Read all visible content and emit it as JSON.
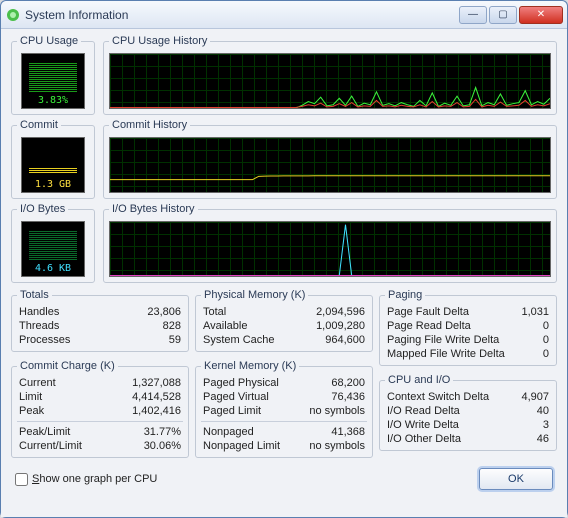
{
  "window": {
    "title": "System Information"
  },
  "sections": {
    "cpu_usage": "CPU Usage",
    "cpu_history": "CPU Usage History",
    "commit": "Commit",
    "commit_history": "Commit History",
    "io": "I/O Bytes",
    "io_history": "I/O Bytes History"
  },
  "meters": {
    "cpu": "3.83%",
    "commit": "1.3 GB",
    "io": "4.6 KB"
  },
  "totals": {
    "legend": "Totals",
    "handles_k": "Handles",
    "handles_v": "23,806",
    "threads_k": "Threads",
    "threads_v": "828",
    "processes_k": "Processes",
    "processes_v": "59"
  },
  "commit_charge": {
    "legend": "Commit Charge (K)",
    "current_k": "Current",
    "current_v": "1,327,088",
    "limit_k": "Limit",
    "limit_v": "4,414,528",
    "peak_k": "Peak",
    "peak_v": "1,402,416",
    "peak_limit_k": "Peak/Limit",
    "peak_limit_v": "31.77%",
    "current_limit_k": "Current/Limit",
    "current_limit_v": "30.06%"
  },
  "physmem": {
    "legend": "Physical Memory (K)",
    "total_k": "Total",
    "total_v": "2,094,596",
    "avail_k": "Available",
    "avail_v": "1,009,280",
    "cache_k": "System Cache",
    "cache_v": "964,600"
  },
  "kernel": {
    "legend": "Kernel Memory (K)",
    "pp_k": "Paged Physical",
    "pp_v": "68,200",
    "pv_k": "Paged Virtual",
    "pv_v": "76,436",
    "pl_k": "Paged Limit",
    "pl_v": "no symbols",
    "np_k": "Nonpaged",
    "np_v": "41,368",
    "nl_k": "Nonpaged Limit",
    "nl_v": "no symbols"
  },
  "paging": {
    "legend": "Paging",
    "pf_k": "Page Fault Delta",
    "pf_v": "1,031",
    "pr_k": "Page Read Delta",
    "pr_v": "0",
    "pw_k": "Paging File Write Delta",
    "pw_v": "0",
    "mw_k": "Mapped File Write Delta",
    "mw_v": "0"
  },
  "cpuio": {
    "legend": "CPU and I/O",
    "cs_k": "Context Switch Delta",
    "cs_v": "4,907",
    "ir_k": "I/O Read Delta",
    "ir_v": "40",
    "iw_k": "I/O Write Delta",
    "iw_v": "3",
    "io_k": "I/O Other Delta",
    "io_v": "46"
  },
  "footer": {
    "checkbox_prefix": "S",
    "checkbox_rest": "how one graph per CPU",
    "ok": "OK"
  },
  "chart_data": [
    {
      "type": "line",
      "title": "CPU Usage History",
      "ylim": [
        0,
        100
      ],
      "series": [
        {
          "name": "cpu-green",
          "color": "#3bf23b",
          "values": [
            0,
            0,
            0,
            0,
            0,
            0,
            0,
            0,
            0,
            0,
            0,
            0,
            0,
            0,
            0,
            0,
            0,
            0,
            0,
            0,
            0,
            0,
            0,
            0,
            0,
            0,
            0,
            0,
            0,
            0,
            0,
            5,
            12,
            8,
            20,
            4,
            6,
            18,
            5,
            22,
            3,
            9,
            6,
            30,
            5,
            8,
            4,
            10,
            6,
            3,
            14,
            4,
            28,
            3,
            9,
            5,
            22,
            4,
            6,
            38,
            4,
            10,
            6,
            26,
            5,
            8,
            10,
            32,
            6,
            12,
            7,
            18
          ]
        },
        {
          "name": "cpu-red",
          "color": "#e04030",
          "values": [
            1,
            1,
            1,
            1,
            1,
            1,
            1,
            1,
            1,
            1,
            1,
            1,
            1,
            1,
            1,
            1,
            1,
            1,
            1,
            1,
            1,
            1,
            1,
            1,
            1,
            1,
            1,
            1,
            1,
            1,
            1,
            3,
            6,
            4,
            9,
            2,
            3,
            8,
            3,
            10,
            2,
            4,
            3,
            14,
            3,
            4,
            2,
            5,
            3,
            2,
            6,
            2,
            12,
            2,
            4,
            3,
            10,
            2,
            3,
            16,
            2,
            5,
            3,
            11,
            3,
            4,
            5,
            14,
            3,
            6,
            4,
            8
          ]
        }
      ]
    },
    {
      "type": "line",
      "title": "Commit History",
      "ylim": [
        0,
        4414528
      ],
      "series": [
        {
          "name": "commit",
          "color": "#e8d020",
          "values": [
            1010000,
            1010000,
            1010000,
            1010000,
            1010000,
            1010000,
            1010000,
            1010000,
            1010000,
            1010000,
            1010000,
            1010000,
            1010000,
            1010000,
            1010000,
            1010000,
            1010000,
            1010000,
            1010000,
            1010000,
            1010000,
            1010000,
            1010000,
            1010000,
            1280000,
            1300000,
            1310000,
            1310000,
            1315000,
            1318000,
            1320000,
            1322000,
            1323000,
            1324000,
            1325000,
            1326000,
            1326000,
            1326500,
            1327000,
            1327088,
            1327088,
            1327088,
            1327088,
            1327088,
            1327088,
            1327088,
            1327088,
            1327088,
            1327088,
            1327088,
            1327088,
            1327088,
            1327088,
            1327088,
            1327088,
            1327088,
            1327088,
            1327088,
            1327088,
            1327088,
            1327088,
            1327088,
            1327088,
            1327088,
            1327088,
            1327088,
            1327088,
            1327088,
            1327088,
            1327088,
            1327088,
            1327088
          ]
        }
      ]
    },
    {
      "type": "line",
      "title": "I/O Bytes History",
      "ylim": [
        0,
        100
      ],
      "series": [
        {
          "name": "io-cyan",
          "color": "#40e0ff",
          "values": [
            1,
            1,
            1,
            1,
            1,
            1,
            1,
            1,
            1,
            1,
            1,
            1,
            1,
            1,
            1,
            1,
            1,
            1,
            1,
            1,
            1,
            1,
            1,
            1,
            1,
            1,
            1,
            1,
            1,
            1,
            1,
            1,
            1,
            1,
            1,
            1,
            1,
            1,
            95,
            1,
            1,
            1,
            1,
            1,
            1,
            1,
            1,
            1,
            1,
            1,
            1,
            1,
            1,
            1,
            1,
            1,
            1,
            1,
            1,
            1,
            1,
            1,
            1,
            1,
            1,
            1,
            1,
            1,
            1,
            1,
            1,
            1
          ]
        },
        {
          "name": "io-magenta",
          "color": "#e040c0",
          "values": [
            1,
            1,
            1,
            1,
            1,
            1,
            1,
            1,
            1,
            1,
            1,
            1,
            1,
            1,
            1,
            1,
            1,
            1,
            1,
            1,
            1,
            1,
            1,
            1,
            1,
            1,
            1,
            1,
            1,
            1,
            1,
            1,
            1,
            1,
            1,
            1,
            1,
            1,
            1,
            1,
            1,
            1,
            1,
            1,
            1,
            1,
            1,
            1,
            1,
            1,
            1,
            1,
            1,
            1,
            1,
            1,
            1,
            1,
            1,
            1,
            1,
            1,
            1,
            1,
            1,
            1,
            1,
            1,
            1,
            1,
            1,
            1
          ]
        }
      ]
    }
  ]
}
